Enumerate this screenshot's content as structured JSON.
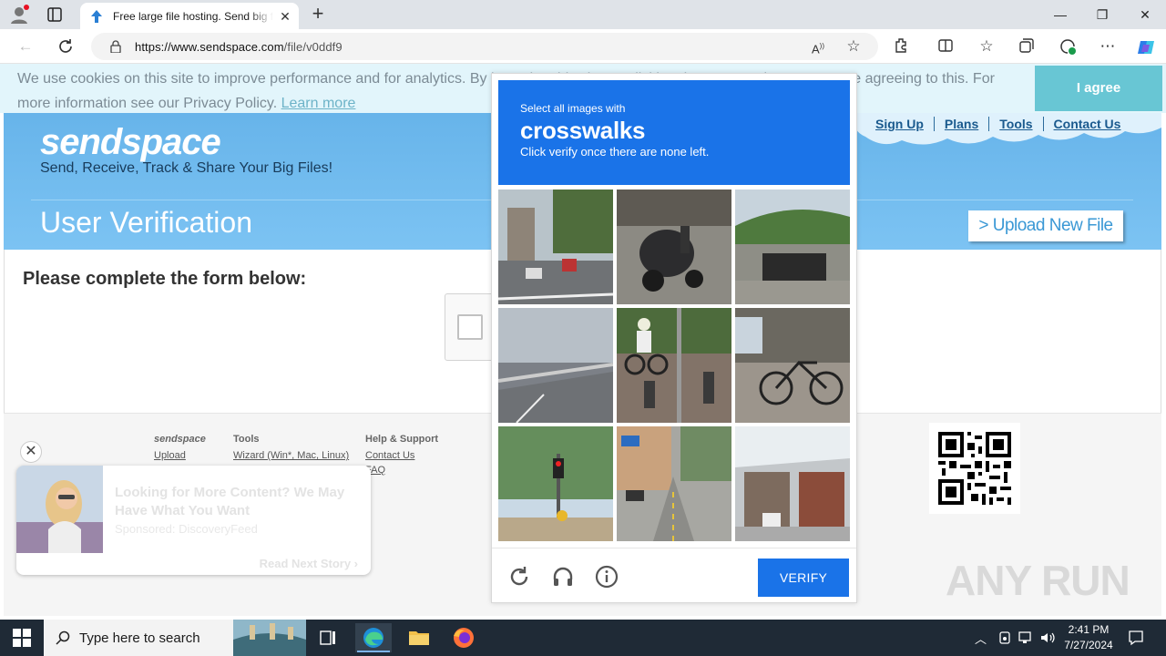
{
  "browser": {
    "tab_title": "Free large file hosting. Send big files",
    "tab_close": "✕",
    "new_tab": "+",
    "url_host": "https://www.sendspace.com",
    "url_path": "/file/v0ddf9",
    "window": {
      "minimize": "—",
      "restore": "❐",
      "close": "✕"
    }
  },
  "cookie_banner": {
    "text": "We use cookies on this site to improve performance and for analytics. By browsing this site, or clicking the \"I agree\" button, you are agreeing to this. For more information see our Privacy Policy.",
    "learn_more": "Learn more",
    "agree": "I agree"
  },
  "site": {
    "logo": "sendspace",
    "tagline": "Send, Receive, Track & Share Your Big Files!",
    "nav": [
      "Sign Up",
      "Plans",
      "Tools",
      "Contact Us"
    ],
    "page_title": "User Verification",
    "upload_button": "> Upload New File",
    "form_heading": "Please complete the form below:"
  },
  "footer": {
    "col1": {
      "heading": "sendspace",
      "links": [
        "Upload"
      ]
    },
    "col2": {
      "heading": "Tools",
      "links": [
        "Wizard (Win*, Mac, Linux)"
      ]
    },
    "col3": {
      "heading": "Help & Support",
      "links": [
        "Contact Us",
        "FAQ"
      ]
    }
  },
  "ad": {
    "close": "✕",
    "title": "Looking for More Content? We May Have What You Want",
    "sponsor": "Sponsored: DiscoveryFeed",
    "read_next": "Read Next Story ›"
  },
  "captcha": {
    "instruction": "Select all images with",
    "target": "crosswalks",
    "hint": "Click verify once there are none left.",
    "verify": "VERIFY",
    "tiles": [
      "street-intersection",
      "motor-scooter",
      "road-tunnel",
      "elevated-highway",
      "cyclist-on-sidewalk",
      "parked-bicycle",
      "traffic-light-crossing",
      "shop-street",
      "storefront-awning"
    ]
  },
  "watermark": "ANY RUN",
  "taskbar": {
    "search_placeholder": "Type here to search",
    "time": "2:41 PM",
    "date": "7/27/2024"
  },
  "colors": {
    "captcha_blue": "#1a73e8",
    "hero_blue": "#6ab6ec",
    "agree_teal": "#68c6d4"
  }
}
